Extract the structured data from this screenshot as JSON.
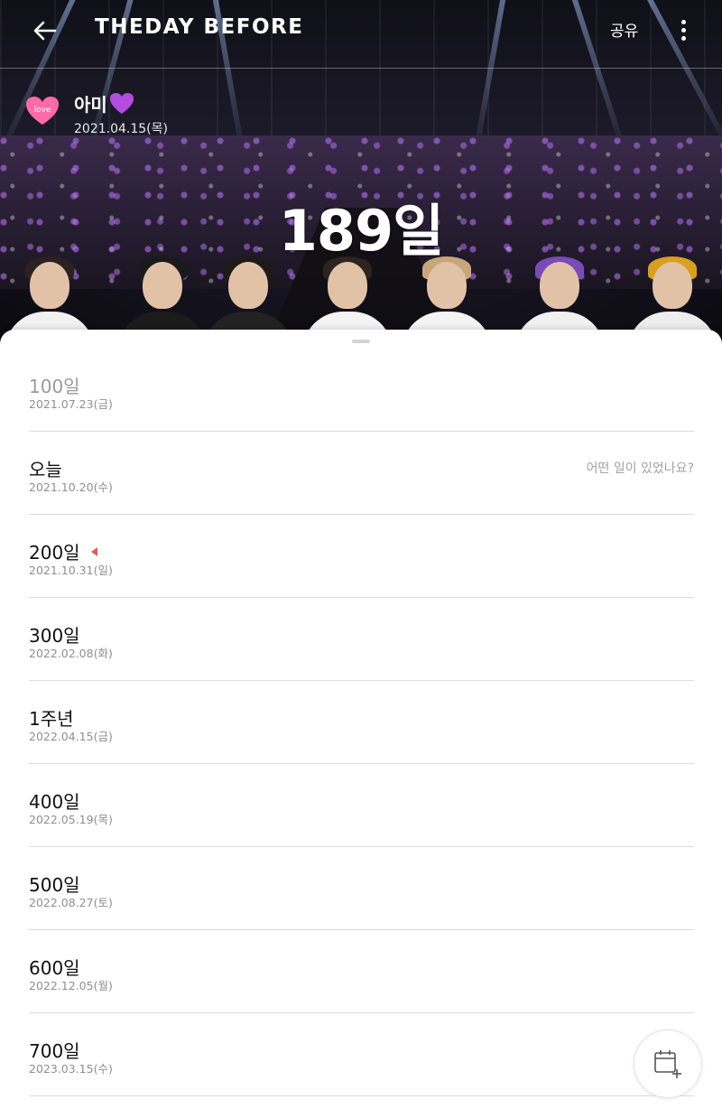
{
  "header": {
    "logo": "THEDAY BEFORE",
    "share_label": "공유",
    "back_icon": "arrow-left-icon",
    "more_icon": "more-vertical-icon"
  },
  "profile": {
    "name": "아미",
    "heart_icon": "purple-heart-icon",
    "badge_icon": "love-heart-badge-icon",
    "badge_text": "love",
    "start_date": "2021.04.15(목)"
  },
  "counter": {
    "value": "189일"
  },
  "milestones": [
    {
      "title": "100일",
      "date": "2021.07.23(금)",
      "past": true
    },
    {
      "title": "오늘",
      "date": "2021.10.20(수)",
      "hint": "어떤 일이 있었나요?"
    },
    {
      "title": "200일",
      "date": "2021.10.31(일)",
      "marker": true
    },
    {
      "title": "300일",
      "date": "2022.02.08(화)"
    },
    {
      "title": "1주년",
      "date": "2022.04.15(금)"
    },
    {
      "title": "400일",
      "date": "2022.05.19(목)"
    },
    {
      "title": "500일",
      "date": "2022.08.27(토)"
    },
    {
      "title": "600일",
      "date": "2022.12.05(월)"
    },
    {
      "title": "700일",
      "date": "2023.03.15(수)"
    }
  ],
  "fab": {
    "icon": "calendar-add-icon"
  },
  "colors": {
    "marker": "#e05a5a",
    "heart": "#b44ce0",
    "badge": "#ff6aa8"
  }
}
